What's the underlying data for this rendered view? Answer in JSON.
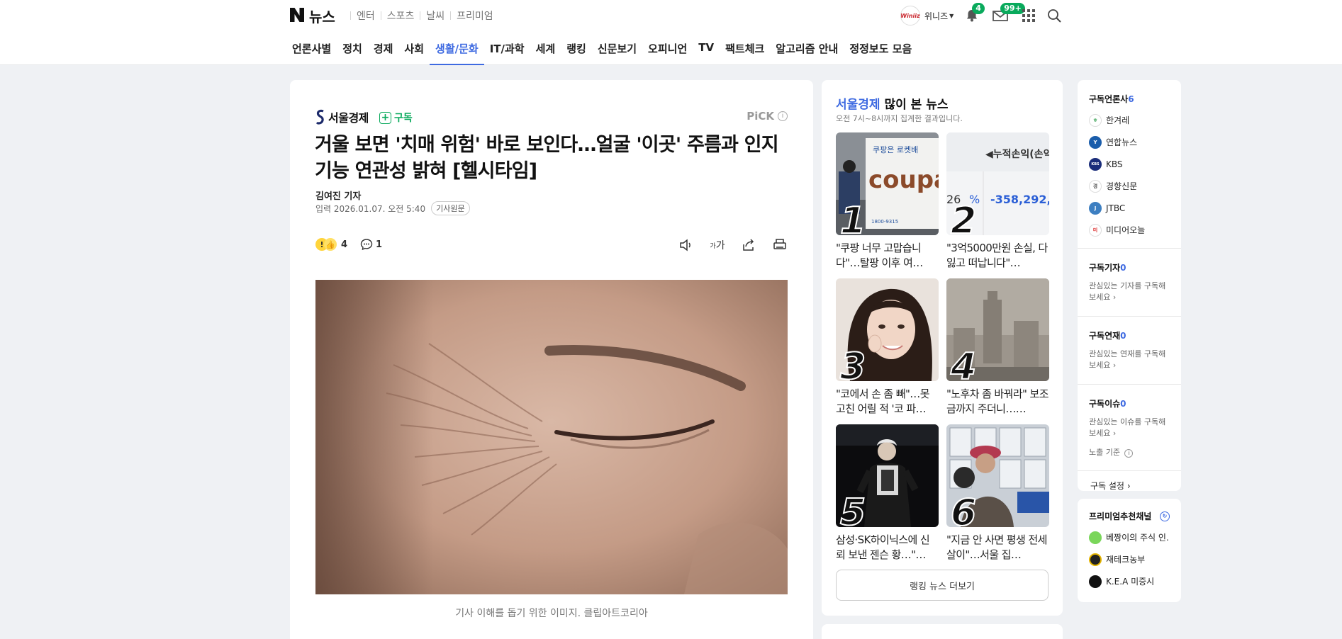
{
  "topbar": {
    "logo_text": "뉴스",
    "service_links": [
      "엔터",
      "스포츠",
      "날씨",
      "프리미엄"
    ],
    "avatar_text": "Winiiz",
    "user_name": "위니즈",
    "notification_count": "4",
    "mail_count": "99+"
  },
  "nav": {
    "items": [
      "언론사별",
      "정치",
      "경제",
      "사회",
      "생활/문화",
      "IT/과학",
      "세계",
      "랭킹",
      "신문보기",
      "오피니언",
      "TV",
      "팩트체크",
      "알고리즘 안내",
      "정정보도 모음"
    ],
    "active": "생활/문화"
  },
  "article": {
    "press_name": "서울경제",
    "subscribe_label": "구독",
    "pick_label": "PiCK",
    "headline": "거울 보면 '치매 위험' 바로 보인다…얼굴 '이곳' 주름과 인지 기능 연관성 밝혀 [헬시타임]",
    "reporter": "김여진 기자",
    "date": "입력 2026.01.07. 오전 5:40",
    "origin_label": "기사원문",
    "reaction_count": "4",
    "comment_count": "1",
    "font_tool_label": "가",
    "caption": "기사 이해를 돕기 위한 이미지. 클립아트코리아"
  },
  "ranking": {
    "press": "서울경제",
    "title_suffix": "많이 본 뉴스",
    "subtitle": "오전 7시~8시까지 집계한 결과입니다.",
    "items": [
      {
        "rank": "1",
        "text": "\"쿠팡 너무 고맙습니다\"…탈팡 이후 여…"
      },
      {
        "rank": "2",
        "text": "\"3억5000만원 손실, 다 잃고 떠납니다\"…"
      },
      {
        "rank": "3",
        "text": "\"코에서 손 좀 빼\"…못 고친 어릴 적 '코 파…"
      },
      {
        "rank": "4",
        "text": "\"노후차 좀 바꿔라\" 보조금까지 주더니……"
      },
      {
        "rank": "5",
        "text": "삼성·SK하이닉스에 신뢰 보낸 젠슨 황…\"…"
      },
      {
        "rank": "6",
        "text": "\"지금 안 사면 평생 전세살이\"…서울 집…"
      }
    ],
    "thumb_texts": {
      "t1_sign": "쿠팡은 로켓배",
      "t1_brand": "coupa",
      "t1_phone": "1800-9315",
      "t2_header": "◀누적손익(손익",
      "t2_left": "26",
      "t2_pct": "%",
      "t2_value": "-358,292,"
    },
    "more_label": "랭킹 뉴스 더보기"
  },
  "sidebar": {
    "subscribed_press": {
      "label": "구독언론사",
      "count": "6"
    },
    "press_list": [
      {
        "name": "한겨레",
        "color": "#ffffff",
        "mark": "ㅎ"
      },
      {
        "name": "연합뉴스",
        "color": "#1a5dab",
        "mark": "Y"
      },
      {
        "name": "KBS",
        "color": "#1a2d7a",
        "mark": "KBS"
      },
      {
        "name": "경향신문",
        "color": "#ffffff",
        "mark": "경"
      },
      {
        "name": "JTBC",
        "color": "#3d7fc1",
        "mark": "J"
      },
      {
        "name": "미디어오늘",
        "color": "#ffffff",
        "mark": "미"
      }
    ],
    "reporters": {
      "label": "구독기자",
      "count": "0",
      "desc": "관심있는 기자를 구독해보세요"
    },
    "series": {
      "label": "구독연재",
      "count": "0",
      "desc": "관심있는 연재를 구독해보세요"
    },
    "issues": {
      "label": "구독이슈",
      "count": "0",
      "desc": "관심있는 이슈를 구독해보세요"
    },
    "exposure_label": "노출 기준",
    "setting_label": "구독 설정",
    "premium": {
      "label": "프리미엄추천채널",
      "channels": [
        {
          "name": "베짱이의 주식 인…",
          "color": "#7ad65a"
        },
        {
          "name": "재테크농부",
          "color": "#222222"
        },
        {
          "name": "K.E.A 미증시",
          "color": "#111111"
        }
      ]
    }
  },
  "colors": {
    "accent": "#3e6ae1",
    "naver_green": "#09aa5c",
    "background": "#eff1f4"
  }
}
